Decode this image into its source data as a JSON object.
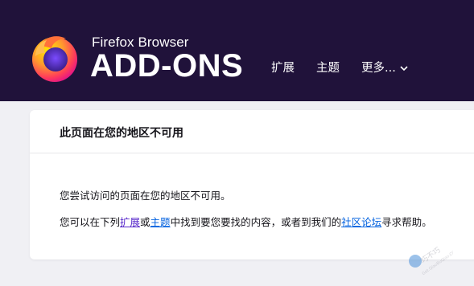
{
  "header": {
    "brand_small": "Firefox Browser",
    "brand_big": "ADD-ONS",
    "nav": {
      "extensions": "扩展",
      "themes": "主题",
      "more": "更多..."
    }
  },
  "notice": {
    "title": "此页面在您的地区不可用",
    "line1": "您尝试访问的页面在您的地区不可用。",
    "line2": {
      "prefix": "您可以在下列",
      "extensions_link": "扩展",
      "or": "或",
      "themes_link": "主题",
      "middle": "中找到要您要找的内容，或者到我们的",
      "community_link": "社区论坛",
      "suffix": "寻求帮助。"
    }
  },
  "watermark": {
    "text": "巧不巧",
    "url": "Get.QiaoBuQiao.COM"
  },
  "colors": {
    "header_bg": "#20123a",
    "page_bg": "#f0f0f4",
    "link_purple": "#592acb",
    "link_blue": "#0060df"
  }
}
